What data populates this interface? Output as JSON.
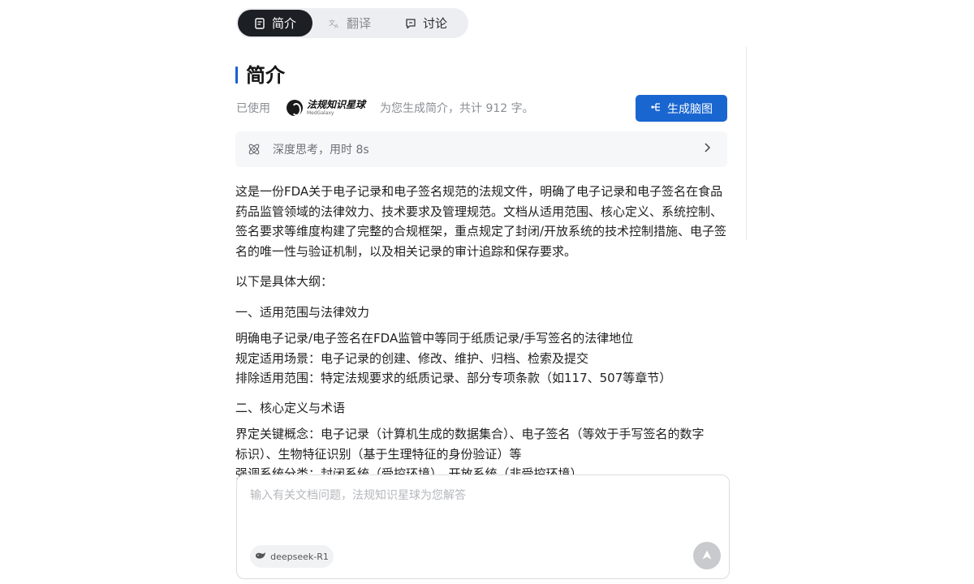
{
  "tabs": [
    {
      "label": "简介",
      "icon": "document-icon",
      "active": true
    },
    {
      "label": "翻译",
      "icon": "translate-icon",
      "active": false
    },
    {
      "label": "讨论",
      "icon": "chat-icon",
      "active": false
    }
  ],
  "section": {
    "title": "简介",
    "used_prefix": "已使用",
    "brand_name": "法规知识星球",
    "brand_sub": "MedGalaxy",
    "summary_note": "为您生成简介，共计 912 字。",
    "mindmap_button": "生成脑图"
  },
  "thinking": {
    "label": "深度思考，用时 8s"
  },
  "content": {
    "intro": "这是一份FDA关于电子记录和电子签名规范的法规文件，明确了电子记录和电子签名在食品药品监管领域的法律效力、技术要求及管理规范。文档从适用范围、核心定义、系统控制、签名要求等维度构建了完整的合规框架，重点规定了封闭/开放系统的技术控制措施、电子签名的唯一性与验证机制，以及相关记录的审计追踪和保存要求。",
    "outline_label": "以下是具体大纲：",
    "sections": [
      {
        "heading": "一、适用范围与法律效力",
        "items": [
          "明确电子记录/电子签名在FDA监管中等同于纸质记录/手写签名的法律地位",
          "规定适用场景：电子记录的创建、修改、维护、归档、检索及提交",
          "排除适用范围：特定法规要求的纸质记录、部分专项条款（如117、507等章节）"
        ]
      },
      {
        "heading": "二、核心定义与术语",
        "items": [
          "界定关键概念：电子记录（计算机生成的数据集合）、电子签名（等效于手写签名的数字标识）、生物特征识别（基于生理特征的身份验证）等",
          "强调系统分类：封闭系统（受控环境）、开放系统（非受控环境）"
        ]
      }
    ]
  },
  "input": {
    "placeholder": "输入有关文档问题，法规知识星球为您解答",
    "model_label": "deepseek-R1"
  },
  "colors": {
    "accent": "#1a66d1",
    "tab_active_bg": "#1c1f24",
    "send_disabled": "#c8cace"
  }
}
